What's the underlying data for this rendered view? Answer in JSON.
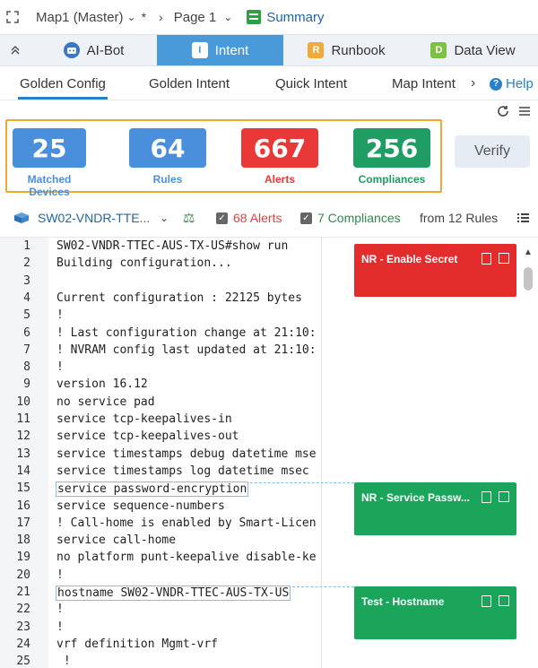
{
  "topbar": {
    "map_title": "Map1 (Master)",
    "star": "*",
    "page_label": "Page 1",
    "summary_label": "Summary"
  },
  "tabs": [
    {
      "label": "AI-Bot",
      "icon": "robot-icon"
    },
    {
      "label": "Intent",
      "icon": "intent-i-icon",
      "active": true
    },
    {
      "label": "Runbook",
      "icon": "runbook-r-icon"
    },
    {
      "label": "Data View",
      "icon": "dataview-d-icon"
    }
  ],
  "tab_icon_letters": {
    "intent": "I",
    "runbook": "R",
    "dataview": "D"
  },
  "subnav": {
    "items": [
      "Golden Config",
      "Golden Intent",
      "Quick Intent",
      "Map Intent"
    ],
    "active": "Golden Config",
    "help": "Help"
  },
  "stats": [
    {
      "value": "25",
      "label": "Matched Devices",
      "color": "#4a8fdc"
    },
    {
      "value": "64",
      "label": "Rules",
      "color": "#4a8fdc"
    },
    {
      "value": "667",
      "label": "Alerts",
      "color": "#e83838"
    },
    {
      "value": "256",
      "label": "Compliances",
      "color": "#1f9d62"
    }
  ],
  "verify_label": "Verify",
  "device": {
    "name": "SW02-VNDR-TTE...",
    "alerts": "68 Alerts",
    "compliances": "7 Compliances",
    "from_rules": "from 12 Rules"
  },
  "code_lines": [
    "SW02-VNDR-TTEC-AUS-TX-US#show run",
    "Building configuration...",
    "",
    "Current configuration : 22125 bytes",
    "!",
    "! Last configuration change at 21:10:",
    "! NVRAM config last updated at 21:10:",
    "!",
    "version 16.12",
    "no service pad",
    "service tcp-keepalives-in",
    "service tcp-keepalives-out",
    "service timestamps debug datetime mse",
    "service timestamps log datetime msec",
    "service password-encryption",
    "service sequence-numbers",
    "! Call-home is enabled by Smart-Licen",
    "service call-home",
    "no platform punt-keepalive disable-ke",
    "!",
    "hostname SW02-VNDR-TTEC-AUS-TX-US",
    "!",
    "!",
    "vrf definition Mgmt-vrf",
    " !"
  ],
  "line_numbers": [
    "1",
    "2",
    "3",
    "4",
    "5",
    "6",
    "7",
    "8",
    "9",
    "10",
    "11",
    "12",
    "13",
    "14",
    "15",
    "16",
    "17",
    "18",
    "19",
    "20",
    "21",
    "22",
    "23",
    "24",
    "25"
  ],
  "rule_cards": [
    {
      "title": "NR - Enable Secret",
      "color": "#e32c2c"
    },
    {
      "title": "NR - Service Passw...",
      "color": "#1aa55a"
    },
    {
      "title": "Test - Hostname",
      "color": "#1aa55a"
    }
  ]
}
